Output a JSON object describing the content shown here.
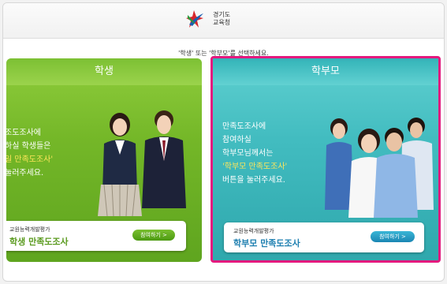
{
  "header": {
    "logo_line1": "경기도",
    "logo_line2": "교육청"
  },
  "prompt": "'학생' 또는 '학부모'를 선택하세요.",
  "student_panel": {
    "title": "학생",
    "handwriting": [
      "조도조사에",
      "하실 학생들은",
      "일 만족도조사'",
      "눌러주세요."
    ],
    "card_sub": "교원능력개발평가",
    "card_main": "학생 만족도조사",
    "button": "참여하기 >",
    "accent": "#6db52a"
  },
  "parent_panel": {
    "title": "학부모",
    "handwriting": [
      "만족도조사에",
      "참여하실",
      "학부모님께서는",
      "'학부모 만족도조사'",
      "버튼을 눌러주세요."
    ],
    "card_sub": "교원능력개발평가",
    "card_main": "학부모 만족도조사",
    "button": "참여하기 >",
    "accent": "#3fbcc0",
    "selected_border": "#e4197e"
  }
}
